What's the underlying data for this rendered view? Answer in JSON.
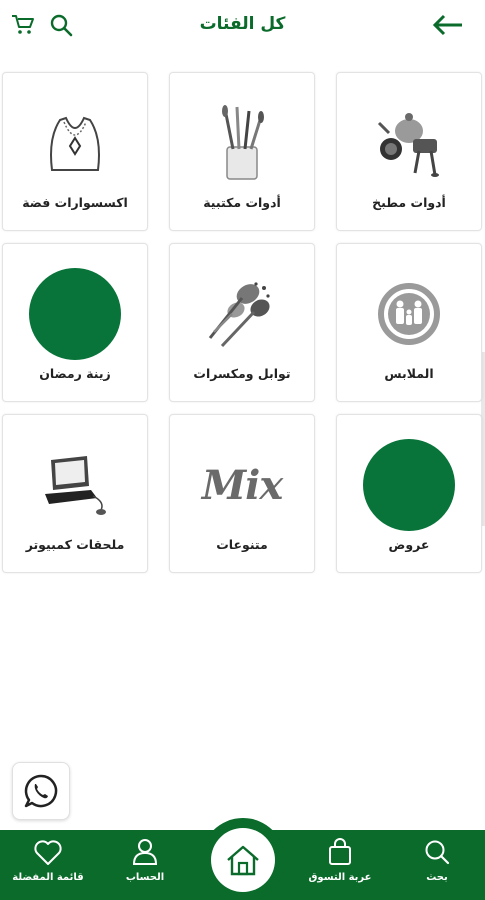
{
  "header": {
    "title": "كل الفئات",
    "icons": {
      "cart": "cart-icon",
      "search": "search-icon",
      "back": "arrow-back-icon"
    }
  },
  "categories": [
    {
      "label": "أدوات مطبخ",
      "icon": "kitchen-tools-image"
    },
    {
      "label": "أدوات مكتبية",
      "icon": "office-tools-image"
    },
    {
      "label": "اكسسوارات فضة",
      "icon": "silver-necklace-image"
    },
    {
      "label": "الملابس",
      "icon": "family-clothes-image"
    },
    {
      "label": "توابل ومكسرات",
      "icon": "spices-image"
    },
    {
      "label": "زينة رمضان",
      "icon": "green-circle-image"
    },
    {
      "label": "عروض",
      "icon": "green-circle-image"
    },
    {
      "label": "متنوعات",
      "icon": "mix-text-image",
      "image_text": "Mix"
    },
    {
      "label": "ملحقات كمبيوتر",
      "icon": "computer-image"
    }
  ],
  "bottom_nav": {
    "search": "بحث",
    "cart": "عربة التسوق",
    "home": "الرئيسية",
    "account": "الحساب",
    "wishlist": "قائمة المفضلة"
  },
  "colors": {
    "brand_green": "#0a6b2b",
    "circle_green": "#08743a"
  }
}
